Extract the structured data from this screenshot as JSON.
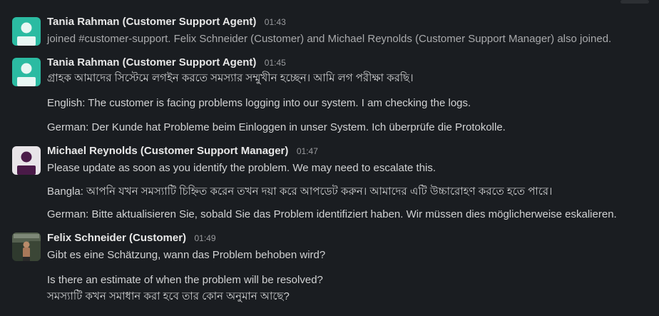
{
  "messages": [
    {
      "sender": "Tania Rahman (Customer Support Agent)",
      "time": "01:43",
      "avatar": "teal-person-icon",
      "lines": [
        "joined #customer-support. Felix Schneider (Customer) and Michael Reynolds (Customer Support Manager) also joined."
      ]
    },
    {
      "sender": "Tania Rahman (Customer Support Agent)",
      "time": "01:45",
      "avatar": "teal-person-icon",
      "lines": [
        "গ্রাহক আমাদের সিস্টেমে লগইন করতে সমস্যার সম্মুখীন হচ্ছেন। আমি লগ পরীক্ষা করছি।",
        "English: The customer is facing problems logging into our system. I am checking the logs.",
        "German: Der Kunde hat Probleme beim Einloggen in unser System. Ich überprüfe die Protokolle."
      ]
    },
    {
      "sender": "Michael Reynolds (Customer Support Manager)",
      "time": "01:47",
      "avatar": "purple-person-icon",
      "lines": [
        "Please update as soon as you identify the problem. We may need to escalate this.",
        "Bangla: আপনি যখন সমস্যাটি চিহ্নিত করেন তখন দয়া করে আপডেট করুন। আমাদের এটি উচ্চারোহণ করতে হতে পারে।",
        "German: Bitte aktualisieren Sie, sobald Sie das Problem identifiziert haben. Wir müssen dies möglicherweise eskalieren."
      ]
    },
    {
      "sender": "Felix Schneider (Customer)",
      "time": "01:49",
      "avatar": "photo-avatar-icon",
      "lines": [
        "Gibt es eine Schätzung, wann das Problem behoben wird?",
        "Is there an estimate of when the problem will be resolved?",
        "সমস্যাটি কখন সমাধান করা হবে তার কোন অনুমান আছে?"
      ]
    }
  ],
  "colors": {
    "background": "#1a1d21",
    "teal_avatar": "#2bbba2",
    "purple_avatar": "#4a1a48"
  }
}
